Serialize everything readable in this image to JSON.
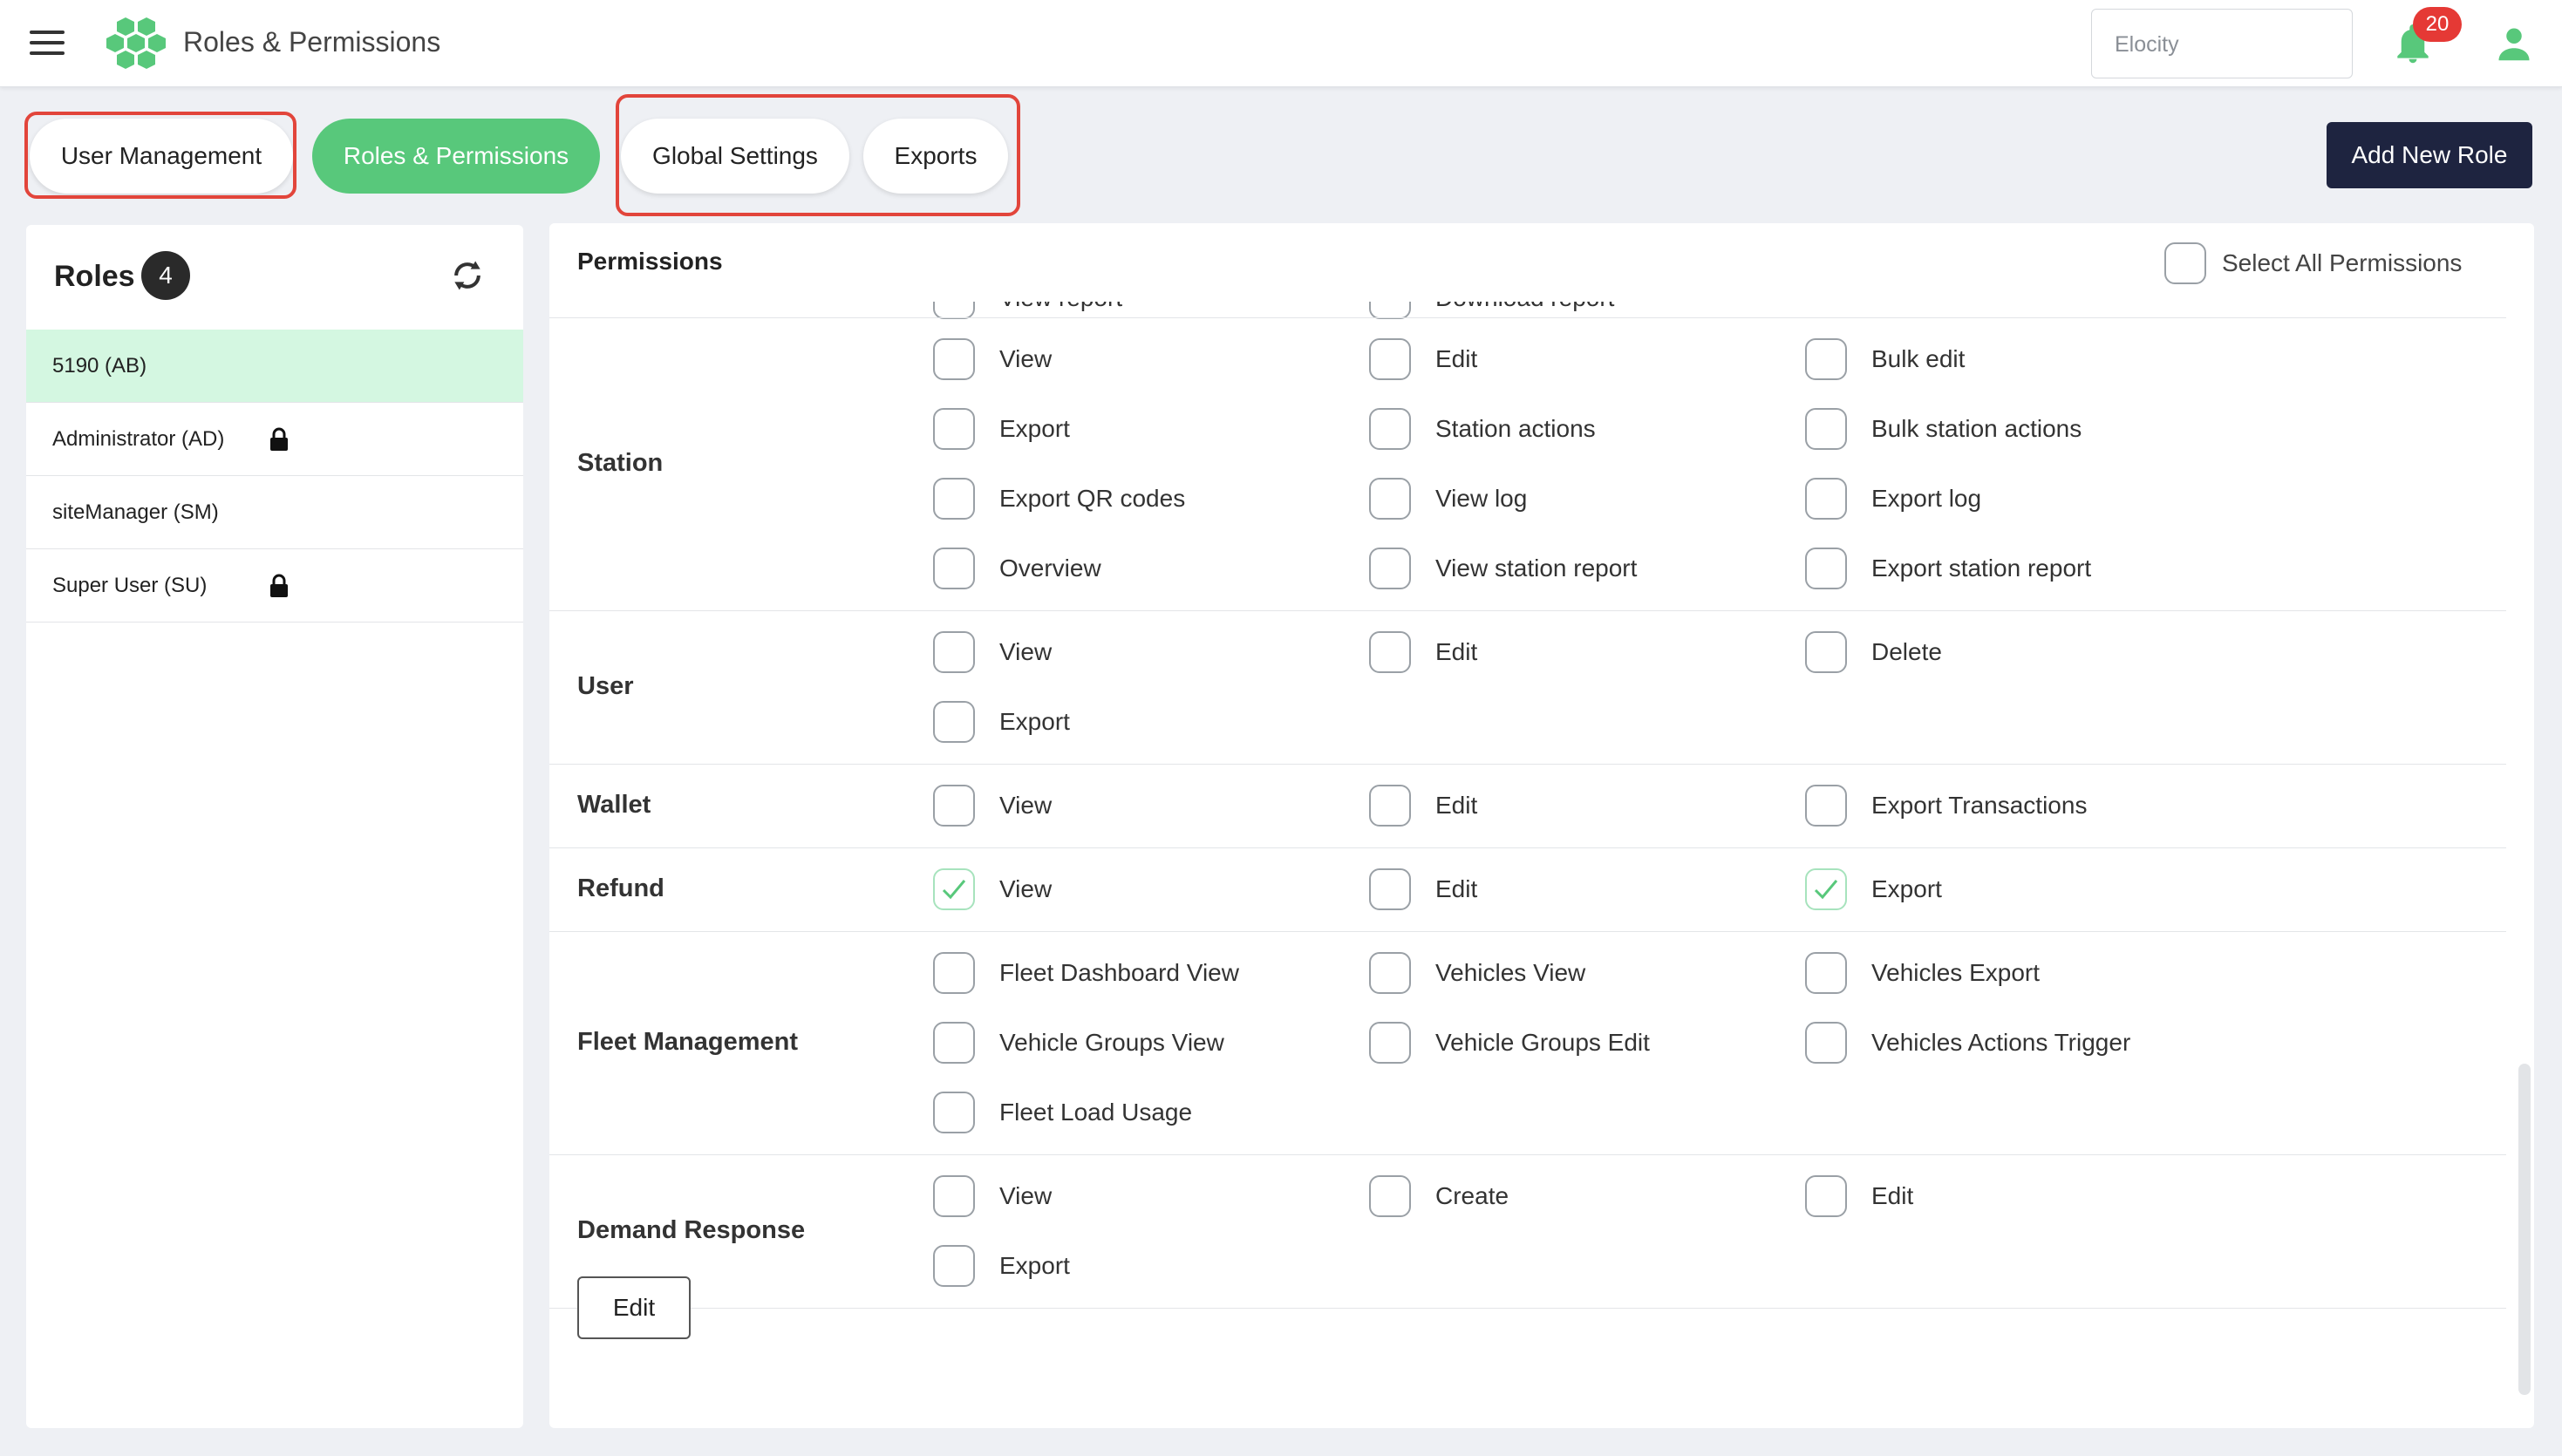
{
  "header": {
    "app_title": "Roles & Permissions",
    "org_value": "Elocity",
    "notification_count": "20"
  },
  "tabs": [
    {
      "label": "User Management"
    },
    {
      "label": "Roles & Permissions"
    },
    {
      "label": "Global Settings"
    },
    {
      "label": "Exports"
    }
  ],
  "add_role_label": "Add New Role",
  "roles": {
    "title": "Roles",
    "count": "4",
    "items": [
      {
        "label": "5190 (AB)",
        "locked": false
      },
      {
        "label": "Administrator (AD)",
        "locked": true
      },
      {
        "label": "siteManager (SM)",
        "locked": false
      },
      {
        "label": "Super User (SU)",
        "locked": true
      }
    ]
  },
  "permissions": {
    "title": "Permissions",
    "select_all_label": "Select All Permissions",
    "partial_row": [
      "View report",
      "Download report"
    ],
    "sections": [
      {
        "name": "Station",
        "items": [
          {
            "label": "View",
            "checked": false
          },
          {
            "label": "Edit",
            "checked": false
          },
          {
            "label": "Bulk edit",
            "checked": false
          },
          {
            "label": "Export",
            "checked": false
          },
          {
            "label": "Station actions",
            "checked": false
          },
          {
            "label": "Bulk station actions",
            "checked": false
          },
          {
            "label": "Export QR codes",
            "checked": false
          },
          {
            "label": "View log",
            "checked": false
          },
          {
            "label": "Export log",
            "checked": false
          },
          {
            "label": "Overview",
            "checked": false
          },
          {
            "label": "View station report",
            "checked": false
          },
          {
            "label": "Export station report",
            "checked": false
          }
        ]
      },
      {
        "name": "User",
        "items": [
          {
            "label": "View",
            "checked": false
          },
          {
            "label": "Edit",
            "checked": false
          },
          {
            "label": "Delete",
            "checked": false
          },
          {
            "label": "Export",
            "checked": false
          }
        ]
      },
      {
        "name": "Wallet",
        "items": [
          {
            "label": "View",
            "checked": false
          },
          {
            "label": "Edit",
            "checked": false
          },
          {
            "label": "Export Transactions",
            "checked": false
          }
        ]
      },
      {
        "name": "Refund",
        "items": [
          {
            "label": "View",
            "checked": true
          },
          {
            "label": "Edit",
            "checked": false
          },
          {
            "label": "Export",
            "checked": true
          }
        ]
      },
      {
        "name": "Fleet Management",
        "items": [
          {
            "label": "Fleet Dashboard View",
            "checked": false
          },
          {
            "label": "Vehicles View",
            "checked": false
          },
          {
            "label": "Vehicles Export",
            "checked": false
          },
          {
            "label": "Vehicle Groups View",
            "checked": false
          },
          {
            "label": "Vehicle Groups Edit",
            "checked": false
          },
          {
            "label": "Vehicles Actions Trigger",
            "checked": false
          },
          {
            "label": "Fleet Load Usage",
            "checked": false
          }
        ]
      },
      {
        "name": "Demand Response",
        "items": [
          {
            "label": "View",
            "checked": false
          },
          {
            "label": "Create",
            "checked": false
          },
          {
            "label": "Edit",
            "checked": false
          },
          {
            "label": "Export",
            "checked": false
          }
        ]
      }
    ],
    "edit_label": "Edit"
  },
  "colors": {
    "accent_green": "#58c87b",
    "selected_role_bg": "#d4f7e1",
    "primary_dark": "#1e2440",
    "highlight_red": "#e2453b",
    "badge_red": "#e53935"
  }
}
